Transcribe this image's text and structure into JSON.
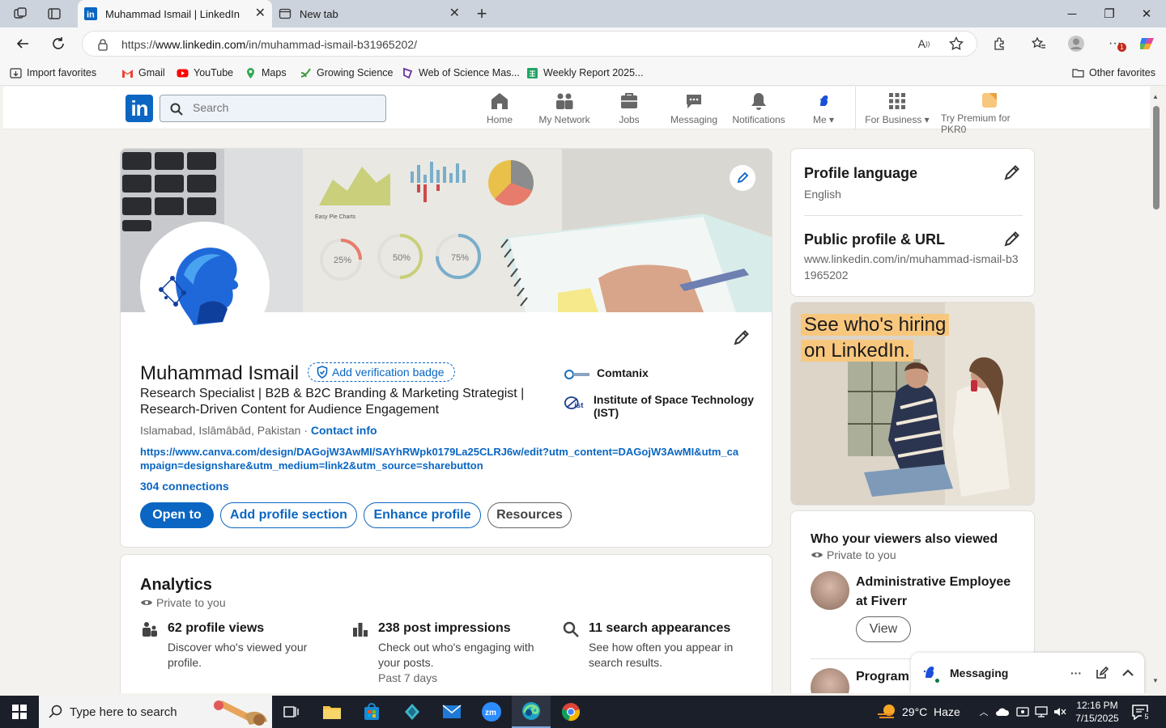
{
  "browser": {
    "tabs": [
      {
        "label": "Muhammad Ismail | LinkedIn",
        "active": true
      },
      {
        "label": "New tab",
        "active": false
      }
    ],
    "url_prefix": "https://",
    "url_host": "www.linkedin.com",
    "url_path": "/in/muhammad-ismail-b31965202/",
    "favorites": [
      "Import favorites",
      "Gmail",
      "YouTube",
      "Maps",
      "Growing Science",
      "Web of Science Mas...",
      "Weekly Report 2025..."
    ],
    "other_favorites": "Other favorites",
    "notification_count": "1"
  },
  "linkedin_nav": {
    "search_placeholder": "Search",
    "items": [
      "Home",
      "My Network",
      "Jobs",
      "Messaging",
      "Notifications",
      "Me",
      "For Business",
      "Try Premium for PKR0"
    ]
  },
  "profile": {
    "name": "Muhammad Ismail",
    "verify_label": "Add verification badge",
    "headline": "Research Specialist | B2B & B2C Branding & Marketing Strategist | Research-Driven Content for Audience Engagement",
    "location": "Islamabad, Islāmābād, Pakistan · ",
    "contact_info": "Contact info",
    "link": "https://www.canva.com/design/DAGojW3AwMI/SAYhRWpk0179La25CLRJ6w/edit?utm_content=DAGojW3AwMI&utm_campaign=designshare&utm_medium=link2&utm_source=sharebutton",
    "connections": "304 connections",
    "buttons": [
      "Open to",
      "Add profile section",
      "Enhance profile",
      "Resources"
    ],
    "orgs": [
      "Comtanix",
      "Institute of Space Technology (IST)"
    ],
    "banner_labels": {
      "pie": "Easy Pie Charts",
      "p25": "25%",
      "p50": "50%",
      "p75": "75%"
    }
  },
  "analytics": {
    "title": "Analytics",
    "private": "Private to you",
    "stats": [
      {
        "title": "62 profile views",
        "desc": "Discover who's viewed your profile.",
        "foot": ""
      },
      {
        "title": "238 post impressions",
        "desc": "Check out who's engaging with your posts.",
        "foot": "Past 7 days"
      },
      {
        "title": "11 search appearances",
        "desc": "See how often you appear in search results.",
        "foot": ""
      }
    ]
  },
  "right_rail": {
    "lang_title": "Profile language",
    "lang_value": "English",
    "public_title": "Public profile & URL",
    "public_url": "www.linkedin.com/in/muhammad-ismail-b31965202",
    "ad_line1": "See who's hiring",
    "ad_line2": "on LinkedIn.",
    "viewers_title": "Who your viewers also viewed",
    "viewers_private": "Private to you",
    "viewer1": "Administrative Employee at Fiverr",
    "view_btn": "View",
    "viewer2": "Program"
  },
  "messaging": {
    "label": "Messaging"
  },
  "taskbar": {
    "search_placeholder": "Type here to search",
    "weather": "29°C  Haze",
    "time": "12:16 PM",
    "date": "7/15/2025",
    "notif_count": "5"
  },
  "colors": {
    "linkedin_blue": "#0a66c2",
    "page_bg": "#f4f2ee",
    "taskbar": "#1b1f2a"
  }
}
